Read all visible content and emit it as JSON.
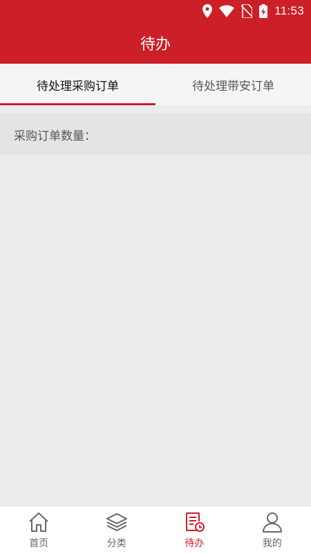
{
  "status_bar": {
    "time": "11:53",
    "icons": [
      "location-icon",
      "wifi-icon",
      "no-sim-icon",
      "battery-charging-icon"
    ]
  },
  "app_bar": {
    "title": "待办"
  },
  "tabs": [
    {
      "label": "待处理采购订单",
      "active": true
    },
    {
      "label": "待处理带安订单",
      "active": false
    }
  ],
  "order_count": {
    "label": "采购订单数量："
  },
  "bottom_nav": [
    {
      "label": "首页",
      "icon": "home-icon",
      "active": false
    },
    {
      "label": "分类",
      "icon": "layers-icon",
      "active": false
    },
    {
      "label": "待办",
      "icon": "todo-document-clock-icon",
      "active": true
    },
    {
      "label": "我的",
      "icon": "user-icon",
      "active": false
    }
  ],
  "colors": {
    "primary": "#cc1f27",
    "background": "#ececec"
  }
}
